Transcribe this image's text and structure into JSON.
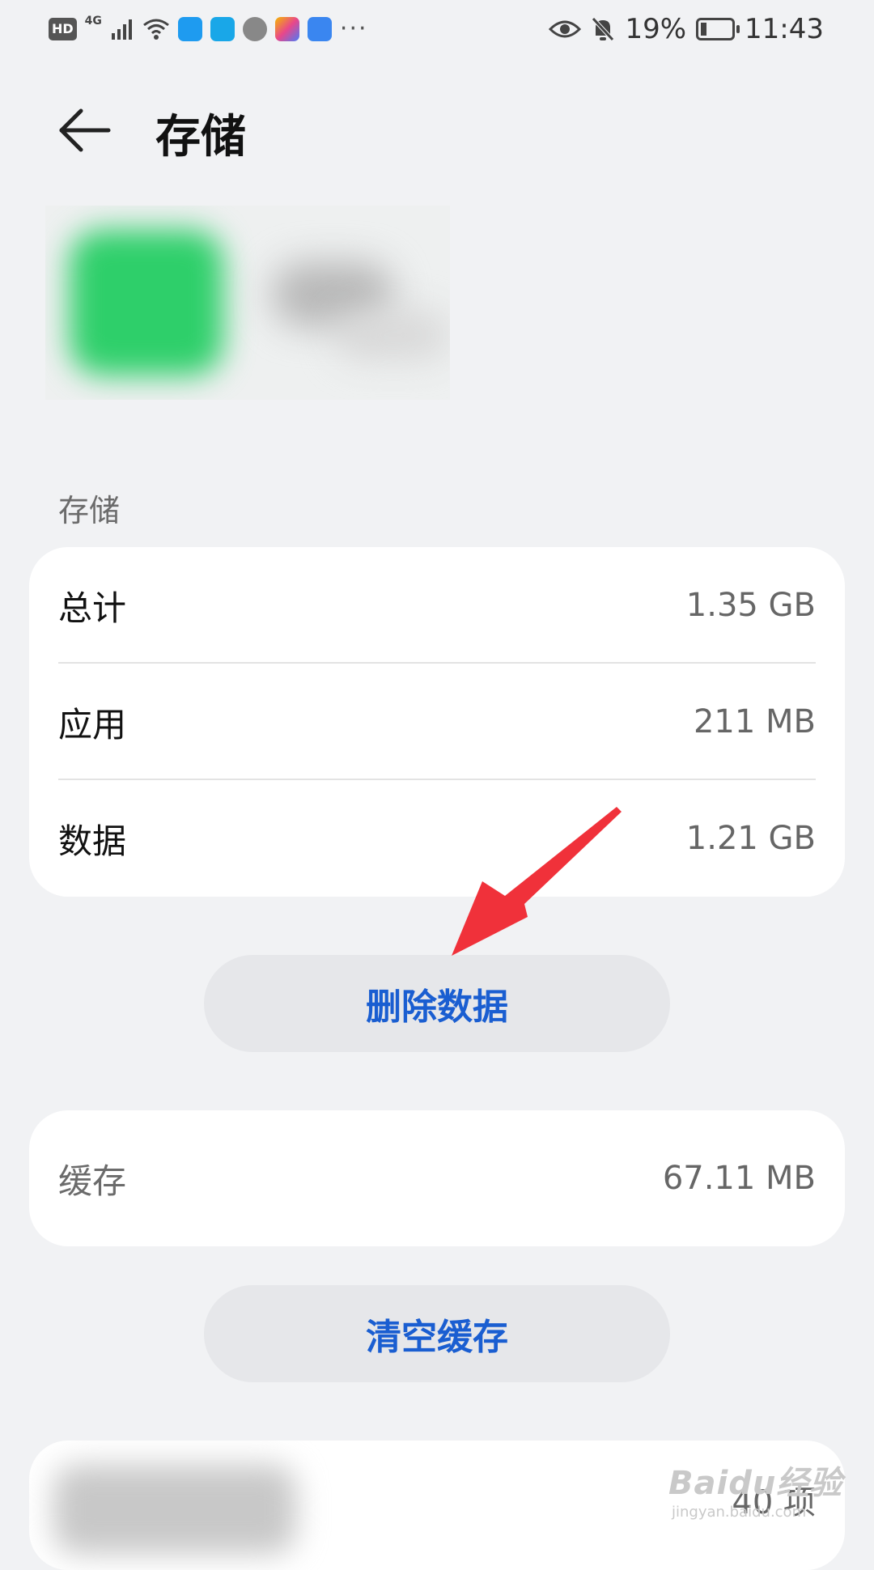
{
  "status_bar": {
    "network_badge": "HD",
    "signal_type": "4G",
    "battery_percent": "19%",
    "battery_level": 0.19,
    "time": "11:43",
    "more": "···"
  },
  "header": {
    "title": "存储"
  },
  "storage_section": {
    "label": "存储",
    "rows": [
      {
        "label": "总计",
        "value": "1.35 GB"
      },
      {
        "label": "应用",
        "value": "211 MB"
      },
      {
        "label": "数据",
        "value": "1.21 GB"
      }
    ],
    "delete_button": "删除数据"
  },
  "cache_section": {
    "label": "缓存",
    "value": "67.11 MB",
    "clear_button": "清空缓存"
  },
  "bottom_row": {
    "value": "40 项"
  },
  "watermark": {
    "main": "Baidu经验",
    "sub": "jingyan.baidu.com"
  },
  "colors": {
    "accent": "#1a5ed1",
    "annotation_arrow": "#f0313a",
    "background": "#f1f2f4"
  }
}
